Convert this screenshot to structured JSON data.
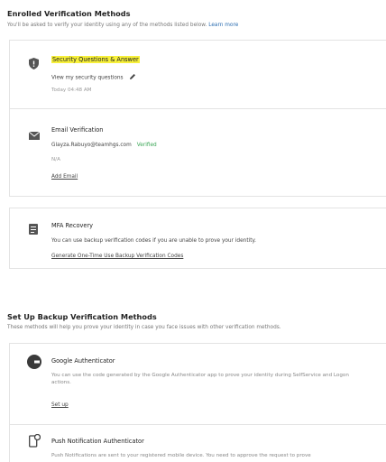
{
  "enrolled": {
    "title": "Enrolled Verification Methods",
    "subtitle": "You'll be asked to verify your identity using any of the methods listed below.",
    "learn_more": "Learn more",
    "security": {
      "title": "Security Questions & Answer",
      "view_link": "View my security questions",
      "timestamp": "Today 04:48 AM"
    },
    "email": {
      "title": "Email Verification",
      "address": "Glayza.Rabuyo@teamhgs.com",
      "status": "Verified",
      "note": "N/A",
      "add_link": "Add Email"
    },
    "mfa": {
      "title": "MFA Recovery",
      "description": "You can use backup verification codes if you are unable to prove your identity.",
      "generate_link": "Generate One-Time Use Backup Verification Codes"
    }
  },
  "backup": {
    "title": "Set Up Backup Verification Methods",
    "subtitle": "These methods will help you prove your identity in case you face issues with other verification methods.",
    "google": {
      "title": "Google Authenticator",
      "description": "You can use the code generated by the Google Authenticator app to prove your identity during SelfService and Logon actions.",
      "setup_link": "Set up"
    },
    "push": {
      "title": "Push Notification Authenticator",
      "description": "Push Notifications are sent to your registered mobile device. You need to approve the request to prove"
    }
  },
  "icons": {
    "shield": "shield-icon",
    "email": "envelope-icon",
    "mfa": "backup-codes-icon",
    "google": "google-authenticator-icon",
    "push": "mobile-push-icon",
    "edit": "pencil-icon"
  },
  "colors": {
    "highlight": "#f7f03a",
    "link": "#2a6cb0",
    "verified": "#3aa655"
  }
}
